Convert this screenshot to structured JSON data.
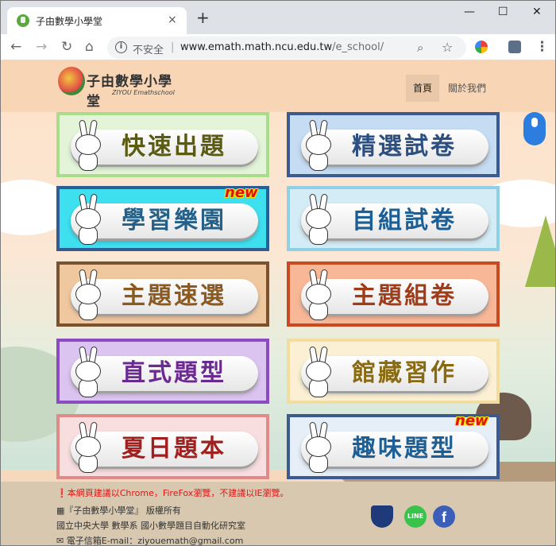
{
  "browser": {
    "tab_title": "子由數學小學堂",
    "tab_close": "×",
    "new_tab": "+",
    "window_controls": [
      "—",
      "☐",
      "✕"
    ],
    "security_label": "不安全",
    "url_host": "www.emath.math.ncu.edu.tw",
    "url_path": "/e_school/",
    "back_icon": "arrow-left-icon",
    "forward_icon": "arrow-right-icon",
    "reload_icon": "reload-icon",
    "home_icon": "home-icon",
    "menu_icon": "three-dots-icon"
  },
  "site": {
    "logo_name": "子由數學小學堂",
    "logo_sub": "ZIYOU Emathschool",
    "nav": [
      "首頁",
      "關於我們"
    ],
    "active_nav": "首頁"
  },
  "cards": [
    {
      "label": "快速出題",
      "border": "#a8dd8c",
      "bg": "#e3f4d8",
      "color": "#5a5a10",
      "new": false
    },
    {
      "label": "精選試卷",
      "border": "#3a5a90",
      "bg": "#c6dcf2",
      "color": "#2b4f80",
      "new": false
    },
    {
      "label": "學習樂園",
      "border": "#2c5e94",
      "bg": "#3ee0f0",
      "color": "#246088",
      "new": true
    },
    {
      "label": "自組試卷",
      "border": "#8fd0e6",
      "bg": "#d4ecf6",
      "color": "#1d5f94",
      "new": false
    },
    {
      "label": "主題速選",
      "border": "#7a5230",
      "bg": "#f0c8a0",
      "color": "#8a5a20",
      "new": false
    },
    {
      "label": "主題組卷",
      "border": "#c84a20",
      "bg": "#f8b898",
      "color": "#a03c18",
      "new": false
    },
    {
      "label": "直式題型",
      "border": "#8a4cc0",
      "bg": "#dcc4f0",
      "color": "#6a2a90",
      "new": false
    },
    {
      "label": "館藏習作",
      "border": "#f2dca0",
      "bg": "#fbf0d4",
      "color": "#8a6a10",
      "new": false
    },
    {
      "label": "夏日題本",
      "border": "#e08a8a",
      "bg": "#f8dede",
      "color": "#a02020",
      "new": false
    },
    {
      "label": "趣味題型",
      "border": "#3a5a90",
      "bg": "#e6eef8",
      "color": "#1d5f94",
      "new": true
    }
  ],
  "new_badge_text": "new",
  "footer": {
    "warning": "本網頁建議以Chrome，FireFox瀏覽，不建議以IE瀏覽。",
    "copyright": "『子由數學小學堂』 版權所有",
    "org": "國立中央大學 數學系 國小數學題目自動化研究室",
    "email": "電子信箱E-mail：ziyouemath@gmail.com",
    "line_label": "LINE"
  }
}
